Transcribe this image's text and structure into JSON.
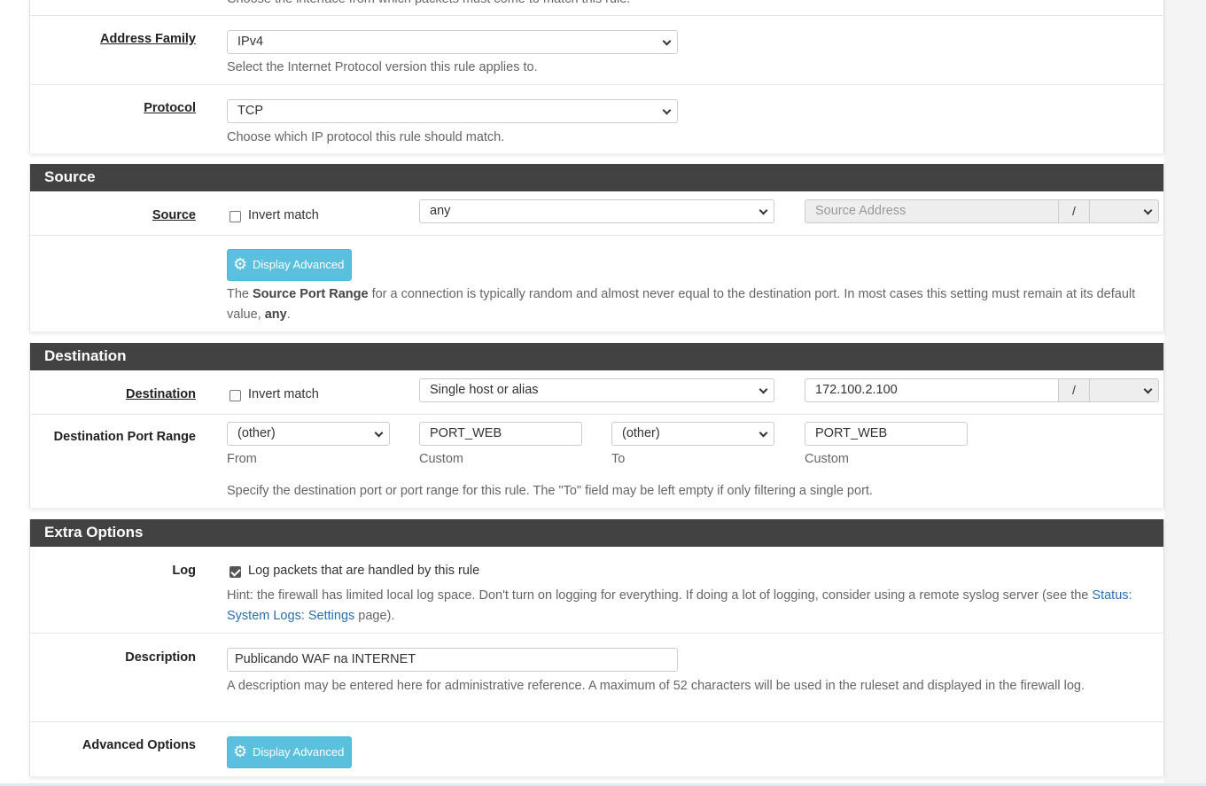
{
  "interface": {
    "help": "Choose the interface from which packets must come to match this rule."
  },
  "address_family": {
    "label": "Address Family",
    "value": "IPv4",
    "help": "Select the Internet Protocol version this rule applies to."
  },
  "protocol": {
    "label": "Protocol",
    "value": "TCP",
    "help": "Choose which IP protocol this rule should match."
  },
  "source": {
    "header": "Source",
    "label": "Source",
    "invert_label": "Invert match",
    "invert_checked": false,
    "type": "any",
    "address_placeholder": "Source Address",
    "slash": "/",
    "mask": "",
    "advanced_button": "Display Advanced",
    "help_pre": "The ",
    "help_bold": "Source Port Range",
    "help_mid": " for a connection is typically random and almost never equal to the destination port. In most cases this setting must remain at its default value, ",
    "help_bold2": "any",
    "help_end": "."
  },
  "destination": {
    "header": "Destination",
    "label": "Destination",
    "invert_label": "Invert match",
    "invert_checked": false,
    "type": "Single host or alias",
    "address": "172.100.2.100",
    "slash": "/",
    "mask": "",
    "port_label": "Destination Port Range",
    "from_select": "(other)",
    "from_custom": "PORT_WEB",
    "to_select": "(other)",
    "to_custom": "PORT_WEB",
    "from_caption": "From",
    "custom_caption": "Custom",
    "to_caption": "To",
    "custom_caption2": "Custom",
    "port_help": "Specify the destination port or port range for this rule. The \"To\" field may be left empty if only filtering a single port."
  },
  "extra": {
    "header": "Extra Options",
    "log_label": "Log",
    "log_checkbox_label": "Log packets that are handled by this rule",
    "log_checked": true,
    "log_hint_pre": "Hint: the firewall has limited local log space. Don't turn on logging for everything. If doing a lot of logging, consider using a remote syslog server (see the ",
    "log_hint_link": "Status: System Logs: Settings",
    "log_hint_post": " page).",
    "description_label": "Description",
    "description_value": "Publicando WAF na INTERNET",
    "description_help": "A description may be entered here for administrative reference. A maximum of 52 characters will be used in the ruleset and displayed in the firewall log.",
    "advanced_label": "Advanced Options",
    "advanced_button": "Display Advanced"
  },
  "colors": {
    "header": "#424242",
    "button": "#5bc0de",
    "link": "#2a6fb0"
  }
}
